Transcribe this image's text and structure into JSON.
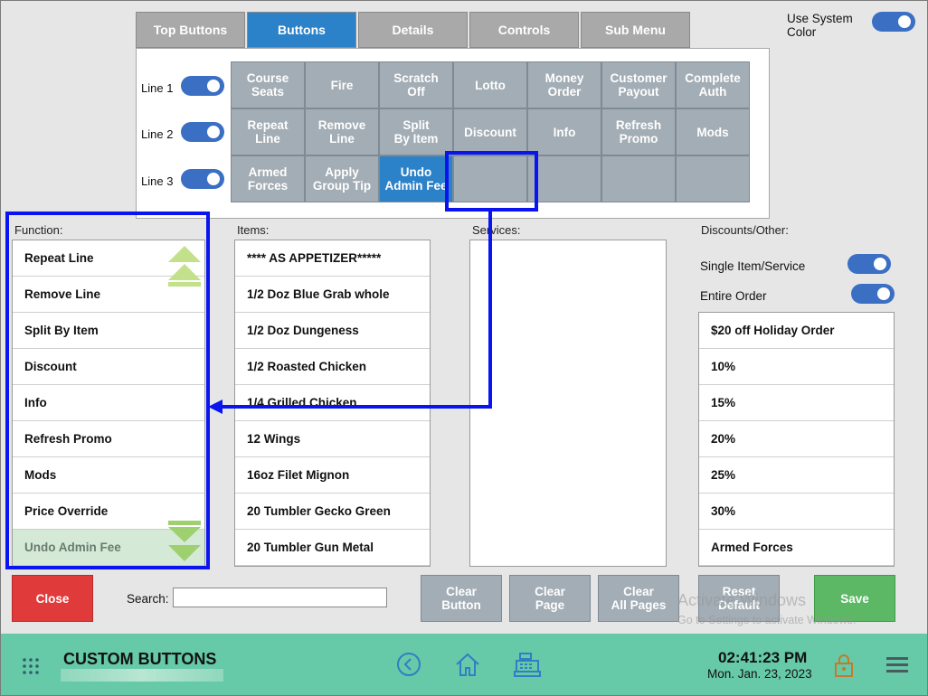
{
  "tabs": [
    {
      "label": "Top Buttons",
      "active": false
    },
    {
      "label": "Buttons",
      "active": true
    },
    {
      "label": "Details",
      "active": false
    },
    {
      "label": "Controls",
      "active": false
    },
    {
      "label": "Sub Menu",
      "active": false
    }
  ],
  "use_system_color": {
    "label": "Use System\nColor",
    "on": true
  },
  "lines": [
    {
      "label": "Line 1",
      "on": true
    },
    {
      "label": "Line 2",
      "on": true
    },
    {
      "label": "Line 3",
      "on": true
    }
  ],
  "grid_buttons": [
    [
      "Course\nSeats",
      "Fire",
      "Scratch\nOff",
      "Lotto",
      "Money\nOrder",
      "Customer\nPayout",
      "Complete\nAuth"
    ],
    [
      "Repeat\nLine",
      "Remove\nLine",
      "Split\nBy Item",
      "Discount",
      "Info",
      "Refresh\nPromo",
      "Mods"
    ],
    [
      "Armed\nForces",
      "Apply\nGroup Tip",
      "Undo\nAdmin Fee",
      "",
      "",
      "",
      ""
    ]
  ],
  "columns": {
    "function": "Function:",
    "items": "Items:",
    "services": "Services:",
    "discounts": "Discounts/Other:"
  },
  "function_list": [
    "Repeat Line",
    "Remove Line",
    "Split By Item",
    "Discount",
    "Info",
    "Refresh Promo",
    "Mods",
    "Price Override",
    "Undo Admin Fee"
  ],
  "items_list": [
    "**** AS APPETIZER*****",
    "1/2 Doz Blue Grab whole",
    "1/2 Doz Dungeness",
    "1/2 Roasted Chicken",
    "1/4 Grilled Chicken",
    "12 Wings",
    "16oz Filet Mignon",
    "20 Tumbler Gecko Green",
    "20 Tumbler Gun Metal"
  ],
  "discount_toggles": [
    {
      "label": "Single Item/Service",
      "on": true
    },
    {
      "label": "Entire Order",
      "on": true
    }
  ],
  "discounts_list": [
    "$20 off Holiday Order",
    "10%",
    "15%",
    "20%",
    "25%",
    "30%",
    "Armed Forces"
  ],
  "actions": {
    "close": "Close",
    "search_label": "Search:",
    "search_value": "",
    "clear_button": "Clear\nButton",
    "clear_page": "Clear\nPage",
    "clear_all_pages": "Clear\nAll Pages",
    "reset_default": "Reset\nDefault",
    "save": "Save"
  },
  "watermark": {
    "line1": "Activate Windows",
    "line2": "Go to Settings to activate Windows."
  },
  "footer": {
    "title": "CUSTOM BUTTONS",
    "time": "02:41:23 PM",
    "date": "Mon. Jan. 23, 2023"
  },
  "colors": {
    "accent": "#2b82c9",
    "footer": "#66c9a8",
    "close": "#e03a3a",
    "save": "#5cb865",
    "highlight": "#0a14f0"
  }
}
